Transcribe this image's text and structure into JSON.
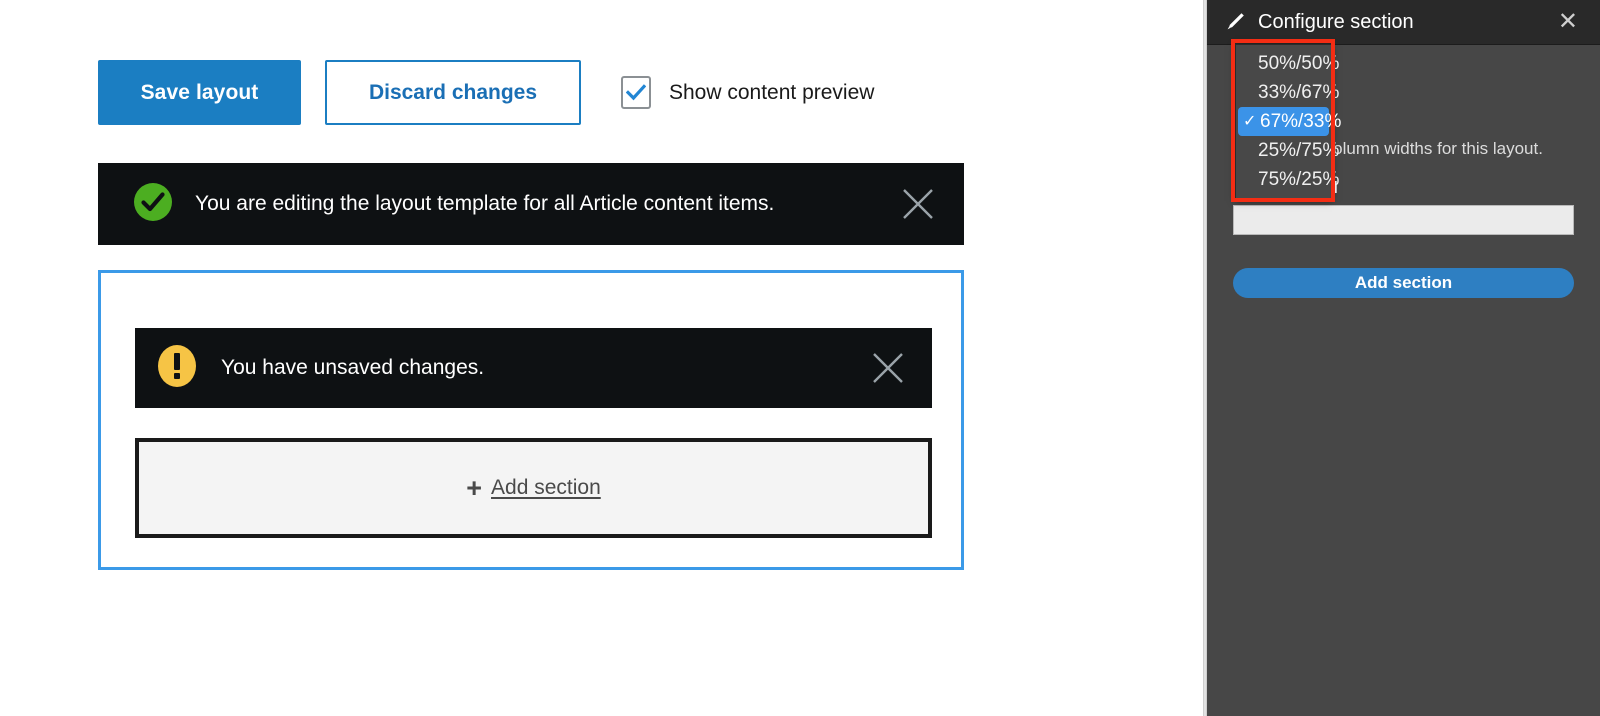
{
  "toolbar": {
    "save_label": "Save layout",
    "discard_label": "Discard changes",
    "preview_checkbox_label": "Show content preview",
    "preview_checkbox_checked": true,
    "save_bg": "#1b7ec2",
    "discard_border": "#1b7ec2",
    "checkmark_color": "#2286d4"
  },
  "messages": {
    "status": {
      "icon": "check-circle-icon",
      "icon_color": "#4cae21",
      "text": "You are editing the layout template for all Article content items.",
      "close_icon": "close-icon",
      "background": "#0e1113"
    },
    "unsaved": {
      "icon": "warning-circle-icon",
      "icon_color": "#f6c445",
      "text": "You have unsaved changes.",
      "close_icon": "close-icon",
      "background": "#0e1113"
    }
  },
  "layout_region": {
    "border_color": "#3b9ae8",
    "add_section": {
      "icon": "plus-icon",
      "label": "Add section"
    }
  },
  "settings_tray": {
    "header": {
      "icon": "pencil-icon",
      "title": "Configure section",
      "close_icon": "close-icon",
      "background": "#292929"
    },
    "background": "#474747",
    "description": "Choose the column widths for this layout.",
    "field_label": "Section label",
    "field_value": "",
    "field_placeholder": "",
    "add_section_button": "Add section",
    "add_section_button_color": "#2e7fc2"
  },
  "width_dropdown": {
    "name": "column-widths-select",
    "selected": "67%/33%",
    "highlight_color": "#3b93e8",
    "check_glyph": "✓",
    "options": [
      {
        "label": "50%/50%",
        "selected": false
      },
      {
        "label": "33%/67%",
        "selected": false
      },
      {
        "label": "67%/33%",
        "selected": true
      },
      {
        "label": "25%/75%",
        "selected": false
      },
      {
        "label": "75%/25%",
        "selected": false
      }
    ]
  },
  "annotation": {
    "name": "red-highlight-box",
    "color": "#f42d14"
  }
}
